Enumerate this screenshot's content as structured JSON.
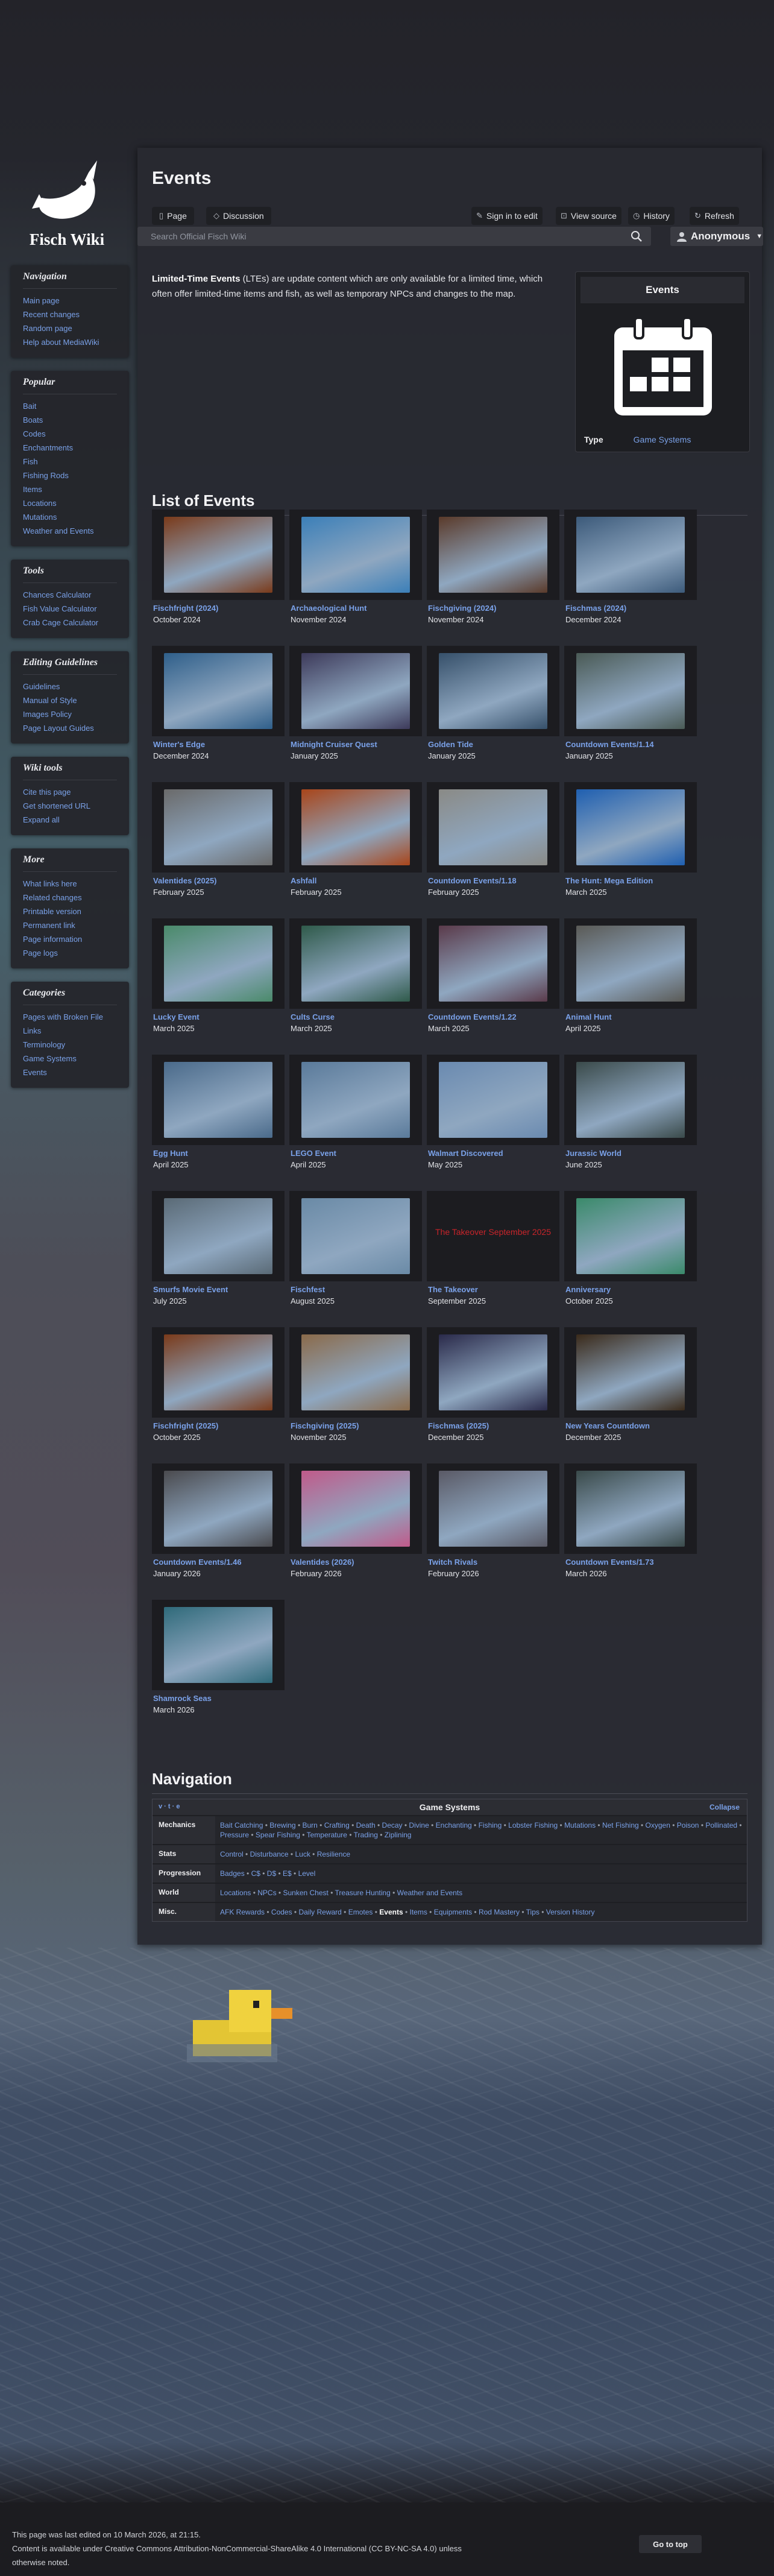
{
  "site": {
    "name": "Fisch Wiki"
  },
  "page": {
    "title": "Events",
    "intro_bold": "Limited-Time Events",
    "intro_rest": " (LTEs) are update content which are only available for a limited time, which often offer limited-time items and fish, as well as temporary NPCs and changes to the map."
  },
  "tabs": {
    "page": "Page",
    "discussion": "Discussion",
    "sign_in": "Sign in to edit",
    "view_source": "View source",
    "history": "History",
    "refresh": "Refresh"
  },
  "search": {
    "placeholder": "Search Official Fisch Wiki"
  },
  "user": {
    "name": "Anonymous"
  },
  "sidebar": {
    "navigation": {
      "title": "Navigation",
      "items": [
        "Main page",
        "Recent changes",
        "Random page",
        "Help about MediaWiki"
      ]
    },
    "popular": {
      "title": "Popular",
      "items": [
        "Bait",
        "Boats",
        "Codes",
        "Enchantments",
        "Fish",
        "Fishing Rods",
        "Items",
        "Locations",
        "Mutations",
        "Weather and Events"
      ]
    },
    "tools": {
      "title": "Tools",
      "items": [
        "Chances Calculator",
        "Fish Value Calculator",
        "Crab Cage Calculator"
      ]
    },
    "editing": {
      "title": "Editing Guidelines",
      "items": [
        "Guidelines",
        "Manual of Style",
        "Images Policy",
        "Page Layout Guides"
      ]
    },
    "wikitools": {
      "title": "Wiki tools",
      "items": [
        "Cite this page",
        "Get shortened URL",
        "Expand all"
      ]
    },
    "more": {
      "title": "More",
      "items": [
        "What links here",
        "Related changes",
        "Printable version",
        "Permanent link",
        "Page information",
        "Page logs"
      ]
    },
    "categories": {
      "title": "Categories",
      "items": [
        "Pages with Broken File Links",
        "Terminology",
        "Game Systems",
        "Events"
      ]
    }
  },
  "infobox": {
    "title": "Events",
    "type_label": "Type",
    "type_value": "Game Systems"
  },
  "list_heading": "List of Events",
  "events": [
    {
      "name": "Fischfright (2024)",
      "date": "October 2024",
      "color": "#7a3a1a"
    },
    {
      "name": "Archaeological Hunt",
      "date": "November 2024",
      "color": "#3b7fb8"
    },
    {
      "name": "Fischgiving (2024)",
      "date": "November 2024",
      "color": "#5a3a2a"
    },
    {
      "name": "Fischmas (2024)",
      "date": "December 2024",
      "color": "#3c5a7a"
    },
    {
      "name": "Winter's Edge",
      "date": "December 2024",
      "color": "#2f5f8a"
    },
    {
      "name": "Midnight Cruiser Quest",
      "date": "January 2025",
      "color": "#3d3a5a"
    },
    {
      "name": "Golden Tide",
      "date": "January 2025",
      "color": "#36506a"
    },
    {
      "name": "Countdown Events/1.14",
      "date": "January 2025",
      "color": "#4a5a55"
    },
    {
      "name": "Valentides (2025)",
      "date": "February 2025",
      "color": "#6a6a6a"
    },
    {
      "name": "Ashfall",
      "date": "February 2025",
      "color": "#a8451a"
    },
    {
      "name": "Countdown Events/1.18",
      "date": "February 2025",
      "color": "#8a8a86"
    },
    {
      "name": "The Hunt: Mega Edition",
      "date": "March 2025",
      "color": "#1f5fb0"
    },
    {
      "name": "Lucky Event",
      "date": "March 2025",
      "color": "#4a8a6a"
    },
    {
      "name": "Cults Curse",
      "date": "March 2025",
      "color": "#2f5a4a"
    },
    {
      "name": "Countdown Events/1.22",
      "date": "March 2025",
      "color": "#5a3a4a"
    },
    {
      "name": "Animal Hunt",
      "date": "April 2025",
      "color": "#5a5a56"
    },
    {
      "name": "Egg Hunt",
      "date": "April 2025",
      "color": "#4a6a8a"
    },
    {
      "name": "LEGO Event",
      "date": "April 2025",
      "color": "#5a7a9a"
    },
    {
      "name": "Walmart Discovered",
      "date": "May 2025",
      "color": "#6a8ab0"
    },
    {
      "name": "Jurassic World",
      "date": "June 2025",
      "color": "#3a4a4a"
    },
    {
      "name": "Smurfs Movie Event",
      "date": "July 2025",
      "color": "#5a6a76"
    },
    {
      "name": "Fischfest",
      "date": "August 2025",
      "color": "#6a8aa6"
    },
    {
      "name": "The Takeover",
      "date": "September 2025",
      "color": "#1c1c20",
      "placeholder": "The Takeover September 2025"
    },
    {
      "name": "Anniversary",
      "date": "October 2025",
      "color": "#3a8a6a"
    },
    {
      "name": "Fischfright (2025)",
      "date": "October 2025",
      "color": "#7a3a1a"
    },
    {
      "name": "Fischgiving (2025)",
      "date": "November 2025",
      "color": "#8a6a4a"
    },
    {
      "name": "Fischmas (2025)",
      "date": "December 2025",
      "color": "#2a2a4a"
    },
    {
      "name": "New Years Countdown",
      "date": "December 2025",
      "color": "#3a2a1a"
    },
    {
      "name": "Countdown Events/1.46",
      "date": "January 2026",
      "color": "#4a4a4e"
    },
    {
      "name": "Valentides (2026)",
      "date": "February 2026",
      "color": "#c05a8a"
    },
    {
      "name": "Twitch Rivals",
      "date": "February 2026",
      "color": "#5a5a66"
    },
    {
      "name": "Countdown Events/1.73",
      "date": "March 2026",
      "color": "#3a4a4a"
    },
    {
      "name": "Shamrock Seas",
      "date": "March 2026",
      "color": "#2f6a7a"
    }
  ],
  "nav_heading": "Navigation",
  "navbox": {
    "vte": "v · t · e",
    "title": "Game Systems",
    "collapse": "Collapse",
    "rows": [
      {
        "label": "Mechanics",
        "items": [
          "Bait Catching",
          "Brewing",
          "Burn",
          "Crafting",
          "Death",
          "Decay",
          "Divine",
          "Enchanting",
          "Fishing",
          "Lobster Fishing",
          "Mutations",
          "Net Fishing",
          "Oxygen",
          "Poison",
          "Pollinated",
          "Pressure",
          "Spear Fishing",
          "Temperature",
          "Trading",
          "Ziplining"
        ]
      },
      {
        "label": "Stats",
        "items": [
          "Control",
          "Disturbance",
          "Luck",
          "Resilience"
        ]
      },
      {
        "label": "Progression",
        "items": [
          "Badges",
          "C$",
          "D$",
          "E$",
          "Level"
        ]
      },
      {
        "label": "World",
        "items": [
          "Locations",
          "NPCs",
          "Sunken Chest",
          "Treasure Hunting",
          "Weather and Events"
        ]
      },
      {
        "label": "Misc.",
        "items": [
          "AFK Rewards",
          "Codes",
          "Daily Reward",
          "Emotes",
          "Events",
          "Items",
          "Equipments",
          "Rod Mastery",
          "Tips",
          "Version History"
        ],
        "current": "Events"
      }
    ]
  },
  "footer": {
    "edited": "This page was last edited on 10 March 2026, at 21:15.",
    "license": "Content is available under Creative Commons Attribution-NonCommercial-ShareAlike 4.0 International (CC BY-NC-SA 4.0) unless otherwise noted.",
    "go_top": "Go to top"
  }
}
